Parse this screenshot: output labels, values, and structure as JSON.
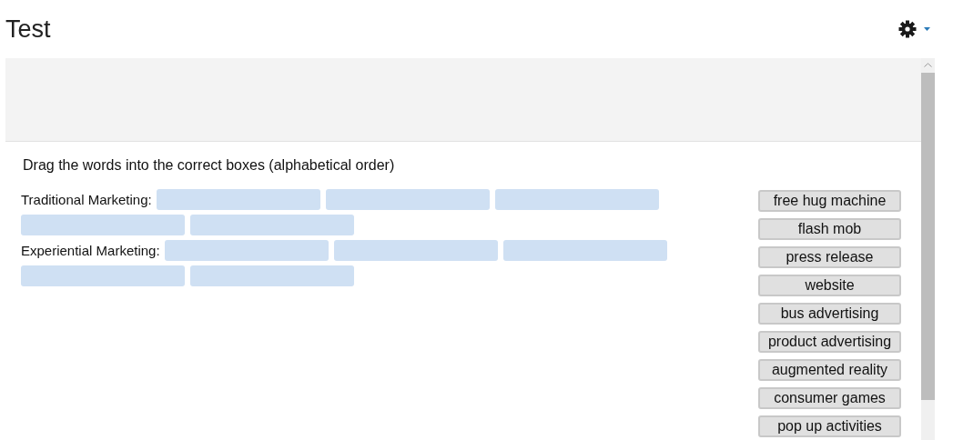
{
  "page_title": "Test",
  "instruction": "Drag the words into the correct boxes (alphabetical order)",
  "categories": [
    {
      "label": "Traditional Marketing:",
      "zones": [
        {
          "filled": false
        },
        {
          "filled": false
        },
        {
          "filled": false
        },
        {
          "filled": false
        },
        {
          "filled": false
        }
      ]
    },
    {
      "label": "Experiential Marketing:",
      "zones": [
        {
          "filled": false
        },
        {
          "filled": false
        },
        {
          "filled": false
        },
        {
          "filled": false
        },
        {
          "filled": false
        }
      ]
    }
  ],
  "word_bank": [
    "free hug machine",
    "flash mob",
    "press release",
    "website",
    "bus advertising",
    "product advertising",
    "augmented reality",
    "consumer games",
    "pop up activities"
  ]
}
